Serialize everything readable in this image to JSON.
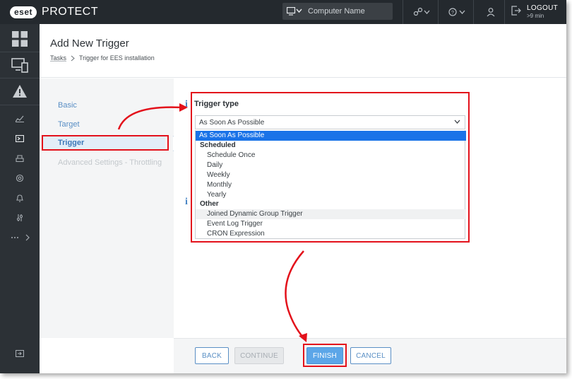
{
  "topbar": {
    "brand_badge": "eset",
    "brand_name": "PROTECT",
    "computer_search_placeholder": "Computer Name",
    "logout_label": "LOGOUT",
    "logout_time": ">9 min"
  },
  "header": {
    "title": "Add New Trigger",
    "breadcrumb": [
      "Tasks",
      "Trigger for EES installation"
    ]
  },
  "left_nav": {
    "items": [
      {
        "label": "Basic"
      },
      {
        "label": "Target"
      },
      {
        "label": "Trigger",
        "active": true
      },
      {
        "label": "Advanced Settings - Throttling",
        "disabled": true
      }
    ]
  },
  "trigger_type": {
    "label": "Trigger type",
    "selected": "As Soon As Possible",
    "options": [
      {
        "label": "As Soon As Possible",
        "highlighted": true
      },
      {
        "label": "Scheduled",
        "group": true
      },
      {
        "label": "Schedule Once"
      },
      {
        "label": "Daily"
      },
      {
        "label": "Weekly"
      },
      {
        "label": "Monthly"
      },
      {
        "label": "Yearly"
      },
      {
        "label": "Other",
        "group": true
      },
      {
        "label": "Joined Dynamic Group Trigger"
      },
      {
        "label": "Event Log Trigger"
      },
      {
        "label": "CRON Expression"
      }
    ]
  },
  "footer": {
    "back": "BACK",
    "continue": "CONTINUE",
    "finish": "FINISH",
    "cancel": "CANCEL"
  },
  "colors": {
    "topbar_bg": "#24292e",
    "sidebar_bg": "#2c3136",
    "accent": "#5a8fc5",
    "highlight": "#1a73e8",
    "annotation": "#e3111b"
  }
}
